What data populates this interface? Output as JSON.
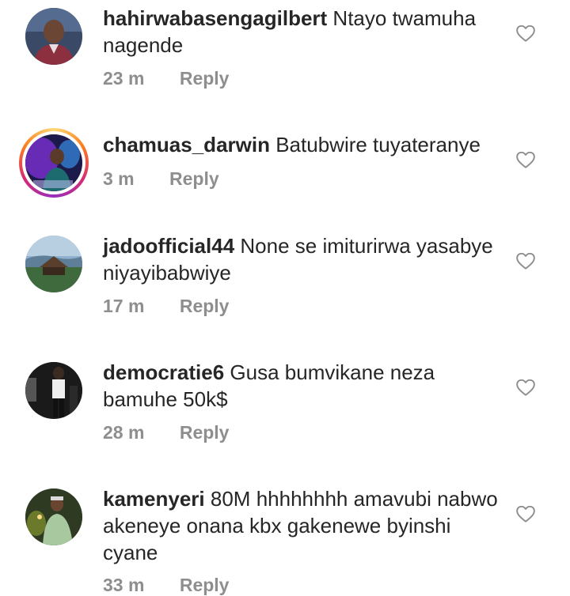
{
  "comments": [
    {
      "username": "hahirwabasengagilbert",
      "text": "Ntayo twamuha nagende",
      "time": "23 m",
      "reply": "Reply"
    },
    {
      "username": "chamuas_darwin",
      "text": "Batubwire tuyateranye",
      "time": "3 m",
      "reply": "Reply"
    },
    {
      "username": "jadoofficial44",
      "text": "None se imiturirwa yasabye niyayibabwiye",
      "time": "17 m",
      "reply": "Reply"
    },
    {
      "username": "democratie6",
      "text": "Gusa bumvikane neza bamuhe 50k$",
      "time": "28 m",
      "reply": "Reply"
    },
    {
      "username": "kamenyeri",
      "text": "80M hhhhhhhh amavubi nabwo akeneye onana kbx gakenewe byinshi cyane",
      "time": "33 m",
      "reply": "Reply"
    }
  ],
  "icons": {
    "like": "heart-outline-icon"
  },
  "colors": {
    "text": "#262626",
    "secondary": "#8e8e8e",
    "story_ring": "#d62976"
  }
}
